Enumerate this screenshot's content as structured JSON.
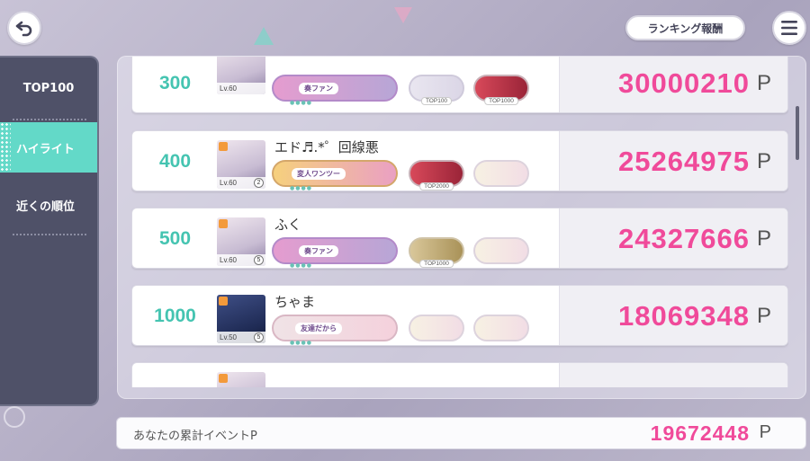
{
  "header": {
    "back_icon": "back-arrow-icon",
    "reward_label": "ランキング報酬",
    "menu_icon": "hamburger-menu-icon"
  },
  "sidebar": {
    "items": [
      {
        "label": "TOP100",
        "selected": false
      },
      {
        "label": "ハイライト",
        "selected": true
      },
      {
        "label": "近くの順位",
        "selected": false
      }
    ],
    "accent_color": "#63d9c8"
  },
  "ranking": {
    "point_unit": "P",
    "rows": [
      {
        "rank": "300",
        "name": "",
        "level": "Lv.60",
        "master_rank": "",
        "titles": [
          {
            "kind": "big",
            "label": "奏ファン",
            "style": "pink"
          },
          {
            "kind": "small",
            "tag": "TOP100",
            "style": "plain"
          },
          {
            "kind": "small",
            "tag": "TOP1000",
            "style": "red"
          }
        ],
        "score": "30000210"
      },
      {
        "rank": "400",
        "name": "エド♬.*゜回線悪",
        "level": "Lv.60",
        "master_rank": "2",
        "titles": [
          {
            "kind": "big",
            "label": "変人ワンツー",
            "style": "orange"
          },
          {
            "kind": "small",
            "tag": "TOP2000",
            "style": "red"
          },
          {
            "kind": "small",
            "tag": "",
            "style": "chibi"
          }
        ],
        "score": "25264975"
      },
      {
        "rank": "500",
        "name": "ふく",
        "level": "Lv.60",
        "master_rank": "5",
        "titles": [
          {
            "kind": "big",
            "label": "奏ファン",
            "style": "pink"
          },
          {
            "kind": "small",
            "tag": "TOP1000",
            "style": "gold"
          },
          {
            "kind": "small",
            "tag": "",
            "style": "chibi"
          }
        ],
        "score": "24327666"
      },
      {
        "rank": "1000",
        "name": "ちゃま",
        "level": "Lv.50",
        "master_rank": "5",
        "titles": [
          {
            "kind": "big",
            "label": "友達だから",
            "style": "pastel"
          },
          {
            "kind": "small",
            "tag": "",
            "style": "chibi"
          },
          {
            "kind": "small",
            "tag": "",
            "style": "chibi"
          }
        ],
        "score": "18069348"
      },
      {
        "rank": "",
        "name": "",
        "level": "",
        "master_rank": "",
        "titles": [],
        "score": ""
      }
    ]
  },
  "total": {
    "label": "あなたの累計イベントP",
    "value": "19672448",
    "unit": "P"
  },
  "colors": {
    "score_pink": "#f04a9a",
    "rank_teal": "#45c4b1"
  }
}
